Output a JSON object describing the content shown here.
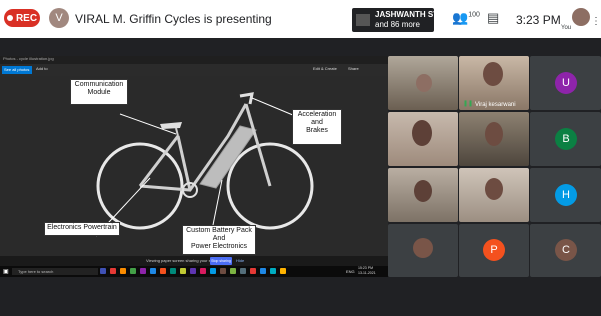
{
  "meeting": {
    "rec_label": "REC",
    "presenter_initial": "V",
    "presenter_text": "VIRAL M. Griffin Cycles is presenting",
    "participants_line1": "JASHWANTH SV...",
    "participants_line2": "and 86 more",
    "participants_count": "100",
    "clock": "3:23 PM",
    "you_label": "You"
  },
  "shared_window": {
    "title": "Photos - cycle illustration.jpg",
    "tab_label": "See all photos",
    "add_label": "Add to",
    "toolbar_right": [
      "Edit & Create",
      "Share"
    ],
    "zoom_hint": "Viewing paper screen sharing your screen",
    "stop_button": "Stop sharing",
    "hide_label": "Hide",
    "taskbar_search": "Type here to search",
    "taskbar_time": "15:23 PM",
    "taskbar_date": "13-11-2021",
    "taskbar_lang": "ENG"
  },
  "diagram_labels": {
    "communication": "Communication\nModule",
    "acceleration": "Acceleration\nand\nBrakes",
    "electronics": "Electronics Powertrain",
    "battery": "Custom Battery Pack\nAnd\nPower Electronics"
  },
  "tiles": {
    "tile2_name": "Viraj kesarwani",
    "avatar_u": "U",
    "avatar_b": "B",
    "avatar_h": "H",
    "avatar_p": "P",
    "avatar_c": "C"
  },
  "colors": {
    "rec": "#d93025",
    "avatar_u": "#8e24aa",
    "avatar_b": "#0b8043",
    "avatar_h": "#039be5",
    "avatar_p": "#f4511e",
    "avatar_c": "#795548"
  }
}
